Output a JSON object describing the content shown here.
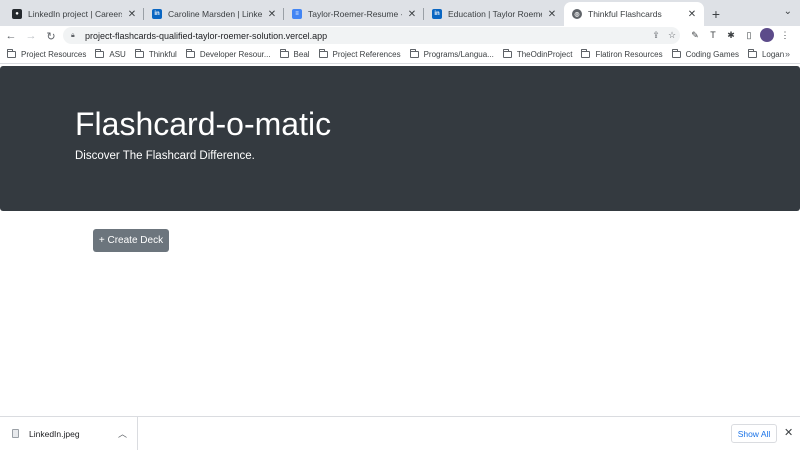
{
  "browser": {
    "tabs": [
      {
        "title": "LinkedIn project | Careers: Per",
        "icon": "github-icon",
        "active": false
      },
      {
        "title": "Caroline Marsden | LinkedIn",
        "icon": "linkedin-icon",
        "active": false
      },
      {
        "title": "Taylor-Roemer-Resume - Goo",
        "icon": "google-docs-icon",
        "active": false
      },
      {
        "title": "Education | Taylor Roemer | Lin",
        "icon": "linkedin-icon",
        "active": false
      },
      {
        "title": "Thinkful Flashcards",
        "icon": "globe-icon",
        "active": true
      }
    ],
    "new_tab_label": "+",
    "url": "project-flashcards-qualified-taylor-roemer-solution.vercel.app",
    "bookmarks": [
      "Project Resources",
      "ASU",
      "Thinkful",
      "Developer Resour...",
      "Beal",
      "Project References",
      "Programs/Langua...",
      "TheOdinProject",
      "Flatiron Resources",
      "Coding Games",
      "Logan"
    ],
    "bookmarks_overflow": "»"
  },
  "page": {
    "title": "Flashcard-o-matic",
    "subtitle": "Discover The Flashcard Difference.",
    "create_deck_label": "+ Create Deck"
  },
  "downloads": {
    "file_name": "LinkedIn.jpeg",
    "show_all_label": "Show All"
  },
  "colors": {
    "jumbotron_bg": "#343a40",
    "button_bg": "#6c757d",
    "link_blue": "#1a73e8"
  }
}
